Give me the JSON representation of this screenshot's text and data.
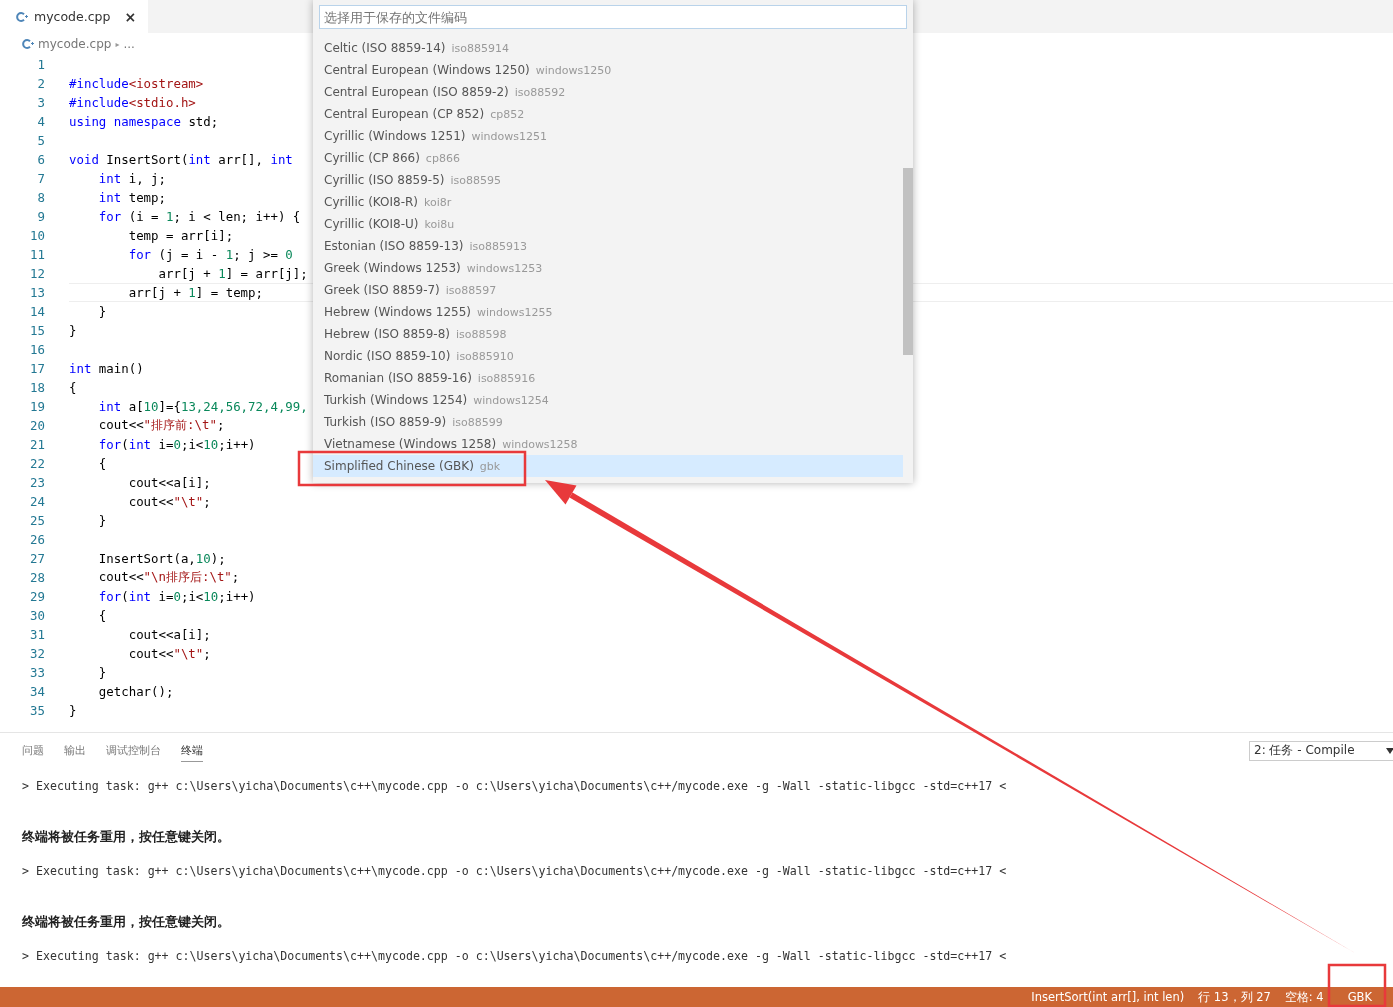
{
  "editor_tabs": [
    {
      "label": "mycode.cpp",
      "close": "×",
      "selected": true
    }
  ],
  "breadcrumb": {
    "file": "mycode.cpp",
    "separator": "▸",
    "more": "..."
  },
  "code": {
    "lines": [
      {
        "number": "1",
        "current": false
      },
      {
        "number": "2",
        "tokens": [
          {
            "kind": "keyword",
            "text": "#include"
          },
          {
            "kind": "string",
            "text": "<iostream>"
          }
        ]
      },
      {
        "number": "3",
        "tokens": [
          {
            "kind": "keyword",
            "text": "#include"
          },
          {
            "kind": "string",
            "text": "<stdio.h>"
          }
        ]
      },
      {
        "number": "4",
        "tokens": [
          {
            "kind": "keyword",
            "text": "using"
          },
          {
            "kind": "keyword",
            "text": " namespace"
          },
          {
            "kind": "plain",
            "text": " std;"
          }
        ]
      },
      {
        "number": "5",
        "current": false
      },
      {
        "number": "6",
        "tokens": [
          {
            "kind": "keyword",
            "text": "void"
          },
          {
            "kind": "plain",
            "text": " InsertSort("
          },
          {
            "kind": "keyword",
            "text": "int"
          },
          {
            "kind": "plain",
            "text": " arr[], "
          },
          {
            "kind": "keyword",
            "text": "int"
          }
        ]
      },
      {
        "number": "7",
        "tokens": [
          {
            "kind": "keyword",
            "text": "    int"
          },
          {
            "kind": "plain",
            "text": " i, j;"
          }
        ]
      },
      {
        "number": "8",
        "tokens": [
          {
            "kind": "keyword",
            "text": "    int"
          },
          {
            "kind": "plain",
            "text": " temp;"
          }
        ]
      },
      {
        "number": "9",
        "tokens": [
          {
            "kind": "keyword",
            "text": "    for"
          },
          {
            "kind": "plain",
            "text": " (i = "
          },
          {
            "kind": "number",
            "text": "1"
          },
          {
            "kind": "plain",
            "text": "; i < len; i++) {"
          }
        ]
      },
      {
        "number": "10",
        "tokens": [
          {
            "kind": "plain",
            "text": "        temp = arr[i];"
          }
        ]
      },
      {
        "number": "11",
        "tokens": [
          {
            "kind": "keyword",
            "text": "        for"
          },
          {
            "kind": "plain",
            "text": " (j = i - "
          },
          {
            "kind": "number",
            "text": "1"
          },
          {
            "kind": "plain",
            "text": "; j >= "
          },
          {
            "kind": "number",
            "text": "0"
          }
        ]
      },
      {
        "number": "12",
        "tokens": [
          {
            "kind": "plain",
            "text": "            arr[j + "
          },
          {
            "kind": "number",
            "text": "1"
          },
          {
            "kind": "plain",
            "text": "] = arr[j];"
          }
        ]
      },
      {
        "number": "13",
        "current": true,
        "tokens": [
          {
            "kind": "plain",
            "text": "        arr[j + "
          },
          {
            "kind": "number",
            "text": "1"
          },
          {
            "kind": "plain",
            "text": "] = temp;"
          }
        ]
      },
      {
        "number": "14",
        "tokens": [
          {
            "kind": "plain",
            "text": "    }"
          }
        ]
      },
      {
        "number": "15",
        "tokens": [
          {
            "kind": "plain",
            "text": "}"
          }
        ]
      },
      {
        "number": "16",
        "current": false
      },
      {
        "number": "17",
        "tokens": [
          {
            "kind": "keyword",
            "text": "int"
          },
          {
            "kind": "plain",
            "text": " main()"
          }
        ]
      },
      {
        "number": "18",
        "tokens": [
          {
            "kind": "plain",
            "text": "{"
          }
        ]
      },
      {
        "number": "19",
        "tokens": [
          {
            "kind": "keyword",
            "text": "    int"
          },
          {
            "kind": "plain",
            "text": " a["
          },
          {
            "kind": "number",
            "text": "10"
          },
          {
            "kind": "plain",
            "text": "]={"
          },
          {
            "kind": "number",
            "text": "13,24,56,72,4,99,"
          }
        ]
      },
      {
        "number": "20",
        "tokens": [
          {
            "kind": "plain",
            "text": "    cout<<"
          },
          {
            "kind": "string",
            "text": "\"排序前:\\t\""
          },
          {
            "kind": "plain",
            "text": ";"
          }
        ]
      },
      {
        "number": "21",
        "tokens": [
          {
            "kind": "keyword",
            "text": "    for"
          },
          {
            "kind": "plain",
            "text": "("
          },
          {
            "kind": "keyword",
            "text": "int"
          },
          {
            "kind": "plain",
            "text": " i="
          },
          {
            "kind": "number",
            "text": "0"
          },
          {
            "kind": "plain",
            "text": ";i<"
          },
          {
            "kind": "number",
            "text": "10"
          },
          {
            "kind": "plain",
            "text": ";i++)"
          }
        ]
      },
      {
        "number": "22",
        "tokens": [
          {
            "kind": "plain",
            "text": "    {"
          }
        ]
      },
      {
        "number": "23",
        "tokens": [
          {
            "kind": "plain",
            "text": "        cout<<a[i];"
          }
        ]
      },
      {
        "number": "24",
        "tokens": [
          {
            "kind": "plain",
            "text": "        cout<<"
          },
          {
            "kind": "string",
            "text": "\"\\t\""
          },
          {
            "kind": "plain",
            "text": ";"
          }
        ]
      },
      {
        "number": "25",
        "tokens": [
          {
            "kind": "plain",
            "text": "    }"
          }
        ]
      },
      {
        "number": "26",
        "current": false
      },
      {
        "number": "27",
        "tokens": [
          {
            "kind": "plain",
            "text": "    InsertSort(a,"
          },
          {
            "kind": "number",
            "text": "10"
          },
          {
            "kind": "plain",
            "text": ");"
          }
        ]
      },
      {
        "number": "28",
        "tokens": [
          {
            "kind": "plain",
            "text": "    cout<<"
          },
          {
            "kind": "string",
            "text": "\"\\n排序后:\\t\""
          },
          {
            "kind": "plain",
            "text": ";"
          }
        ]
      },
      {
        "number": "29",
        "tokens": [
          {
            "kind": "keyword",
            "text": "    for"
          },
          {
            "kind": "plain",
            "text": "("
          },
          {
            "kind": "keyword",
            "text": "int"
          },
          {
            "kind": "plain",
            "text": " i="
          },
          {
            "kind": "number",
            "text": "0"
          },
          {
            "kind": "plain",
            "text": ";i<"
          },
          {
            "kind": "number",
            "text": "10"
          },
          {
            "kind": "plain",
            "text": ";i++)"
          }
        ]
      },
      {
        "number": "30",
        "tokens": [
          {
            "kind": "plain",
            "text": "    {"
          }
        ]
      },
      {
        "number": "31",
        "tokens": [
          {
            "kind": "plain",
            "text": "        cout<<a[i];"
          }
        ]
      },
      {
        "number": "32",
        "tokens": [
          {
            "kind": "plain",
            "text": "        cout<<"
          },
          {
            "kind": "string",
            "text": "\"\\t\""
          },
          {
            "kind": "plain",
            "text": ";"
          }
        ]
      },
      {
        "number": "33",
        "tokens": [
          {
            "kind": "plain",
            "text": "    }"
          }
        ]
      },
      {
        "number": "34",
        "tokens": [
          {
            "kind": "plain",
            "text": "    getchar();"
          }
        ]
      },
      {
        "number": "35",
        "tokens": [
          {
            "kind": "plain",
            "text": "}"
          }
        ]
      }
    ]
  },
  "encoding_picker": {
    "placeholder": "选择用于保存的文件编码",
    "items": [
      {
        "label": "Celtic (ISO 8859-14)",
        "description": "iso885914",
        "selected": false
      },
      {
        "label": "Central European (Windows 1250)",
        "description": "windows1250",
        "selected": false
      },
      {
        "label": "Central European (ISO 8859-2)",
        "description": "iso88592",
        "selected": false
      },
      {
        "label": "Central European (CP 852)",
        "description": "cp852",
        "selected": false
      },
      {
        "label": "Cyrillic (Windows 1251)",
        "description": "windows1251",
        "selected": false
      },
      {
        "label": "Cyrillic (CP 866)",
        "description": "cp866",
        "selected": false
      },
      {
        "label": "Cyrillic (ISO 8859-5)",
        "description": "iso88595",
        "selected": false
      },
      {
        "label": "Cyrillic (KOI8-R)",
        "description": "koi8r",
        "selected": false
      },
      {
        "label": "Cyrillic (KOI8-U)",
        "description": "koi8u",
        "selected": false
      },
      {
        "label": "Estonian (ISO 8859-13)",
        "description": "iso885913",
        "selected": false
      },
      {
        "label": "Greek (Windows 1253)",
        "description": "windows1253",
        "selected": false
      },
      {
        "label": "Greek (ISO 8859-7)",
        "description": "iso88597",
        "selected": false
      },
      {
        "label": "Hebrew (Windows 1255)",
        "description": "windows1255",
        "selected": false
      },
      {
        "label": "Hebrew (ISO 8859-8)",
        "description": "iso88598",
        "selected": false
      },
      {
        "label": "Nordic (ISO 8859-10)",
        "description": "iso885910",
        "selected": false
      },
      {
        "label": "Romanian (ISO 8859-16)",
        "description": "iso885916",
        "selected": false
      },
      {
        "label": "Turkish (Windows 1254)",
        "description": "windows1254",
        "selected": false
      },
      {
        "label": "Turkish (ISO 8859-9)",
        "description": "iso88599",
        "selected": false
      },
      {
        "label": "Vietnamese (Windows 1258)",
        "description": "windows1258",
        "selected": false
      },
      {
        "label": "Simplified Chinese (GBK)",
        "description": "gbk",
        "selected": true
      }
    ]
  },
  "panel": {
    "tabs": [
      {
        "label": "问题",
        "selected": false
      },
      {
        "label": "输出",
        "selected": false
      },
      {
        "label": "调试控制台",
        "selected": false
      },
      {
        "label": "终端",
        "selected": true
      }
    ],
    "terminal_select": "2: 任务 - Compile",
    "terminal": [
      {
        "kind": "command",
        "text": "> Executing task: g++ c:\\Users\\yicha\\Documents\\c++\\mycode.cpp -o c:\\Users\\yicha\\Documents\\c++/mycode.exe -g -Wall -static-libgcc -std=c++17 <"
      },
      {
        "kind": "message",
        "text": "终端将被任务重用，按任意键关闭。"
      },
      {
        "kind": "command",
        "text": "> Executing task: g++ c:\\Users\\yicha\\Documents\\c++\\mycode.cpp -o c:\\Users\\yicha\\Documents\\c++/mycode.exe -g -Wall -static-libgcc -std=c++17 <"
      },
      {
        "kind": "message",
        "text": "终端将被任务重用，按任意键关闭。"
      },
      {
        "kind": "command",
        "text": "> Executing task: g++ c:\\Users\\yicha\\Documents\\c++\\mycode.cpp -o c:\\Users\\yicha\\Documents\\c++/mycode.exe -g -Wall -static-libgcc -std=c++17 <"
      }
    ]
  },
  "status_bar": {
    "items": [
      "InsertSort(int arr[], int len)",
      "行 13，列 27",
      "空格: 4",
      "GBK"
    ]
  }
}
